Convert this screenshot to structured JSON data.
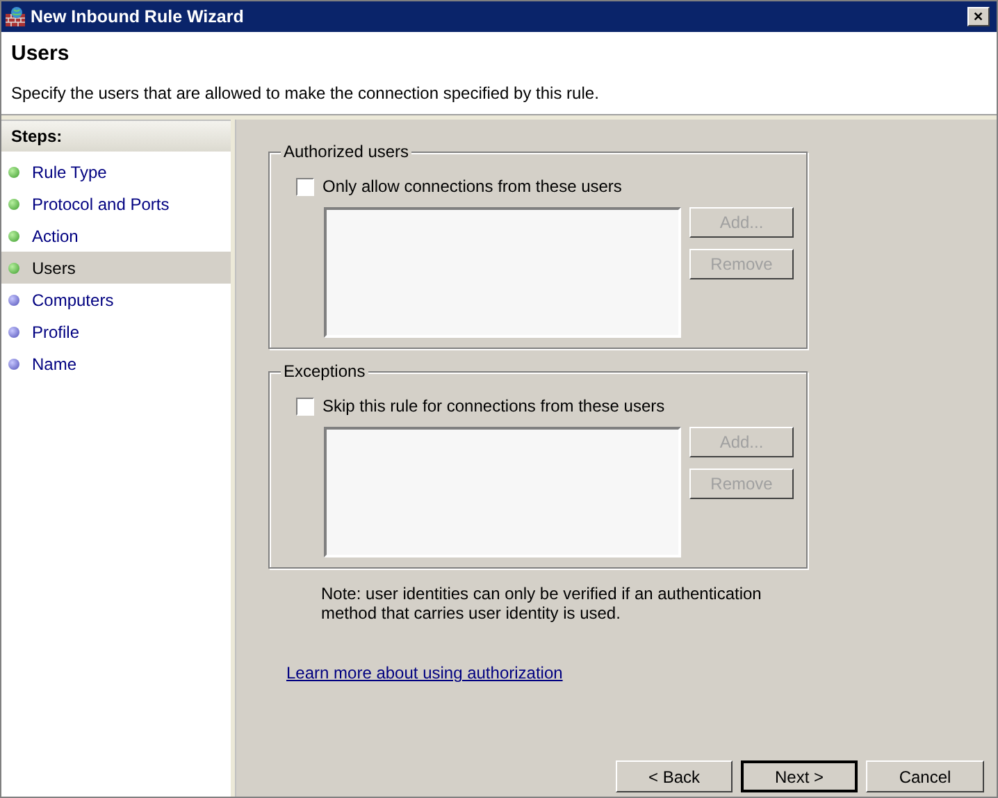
{
  "window": {
    "title": "New Inbound Rule Wizard",
    "close": "✕"
  },
  "header": {
    "title": "Users",
    "description": "Specify the users that are allowed to make the connection specified by this rule."
  },
  "steps": {
    "heading": "Steps:",
    "items": [
      {
        "label": "Rule Type",
        "completed": true,
        "selected": false
      },
      {
        "label": "Protocol and Ports",
        "completed": true,
        "selected": false
      },
      {
        "label": "Action",
        "completed": true,
        "selected": false
      },
      {
        "label": "Users",
        "completed": true,
        "selected": true
      },
      {
        "label": "Computers",
        "completed": false,
        "selected": false
      },
      {
        "label": "Profile",
        "completed": false,
        "selected": false
      },
      {
        "label": "Name",
        "completed": false,
        "selected": false
      }
    ]
  },
  "groups": [
    {
      "title": "Authorized users",
      "checkbox": {
        "label": "Only allow connections from these users",
        "checked": false
      },
      "buttons": [
        {
          "label": "Add...",
          "disabled": true
        },
        {
          "label": "Remove",
          "disabled": true
        }
      ]
    },
    {
      "title": "Exceptions",
      "checkbox": {
        "label": "Skip this rule for connections from these users",
        "checked": false
      },
      "buttons": [
        {
          "label": "Add...",
          "disabled": true
        },
        {
          "label": "Remove",
          "disabled": true
        }
      ]
    }
  ],
  "note": "Note: user identities can only be verified if an authentication method that carries user identity is used.",
  "link": "Learn more about using authorization",
  "footer_buttons": [
    {
      "label": "< Back",
      "default": false
    },
    {
      "label": "Next >",
      "default": true
    },
    {
      "label": "Cancel",
      "default": false
    }
  ]
}
